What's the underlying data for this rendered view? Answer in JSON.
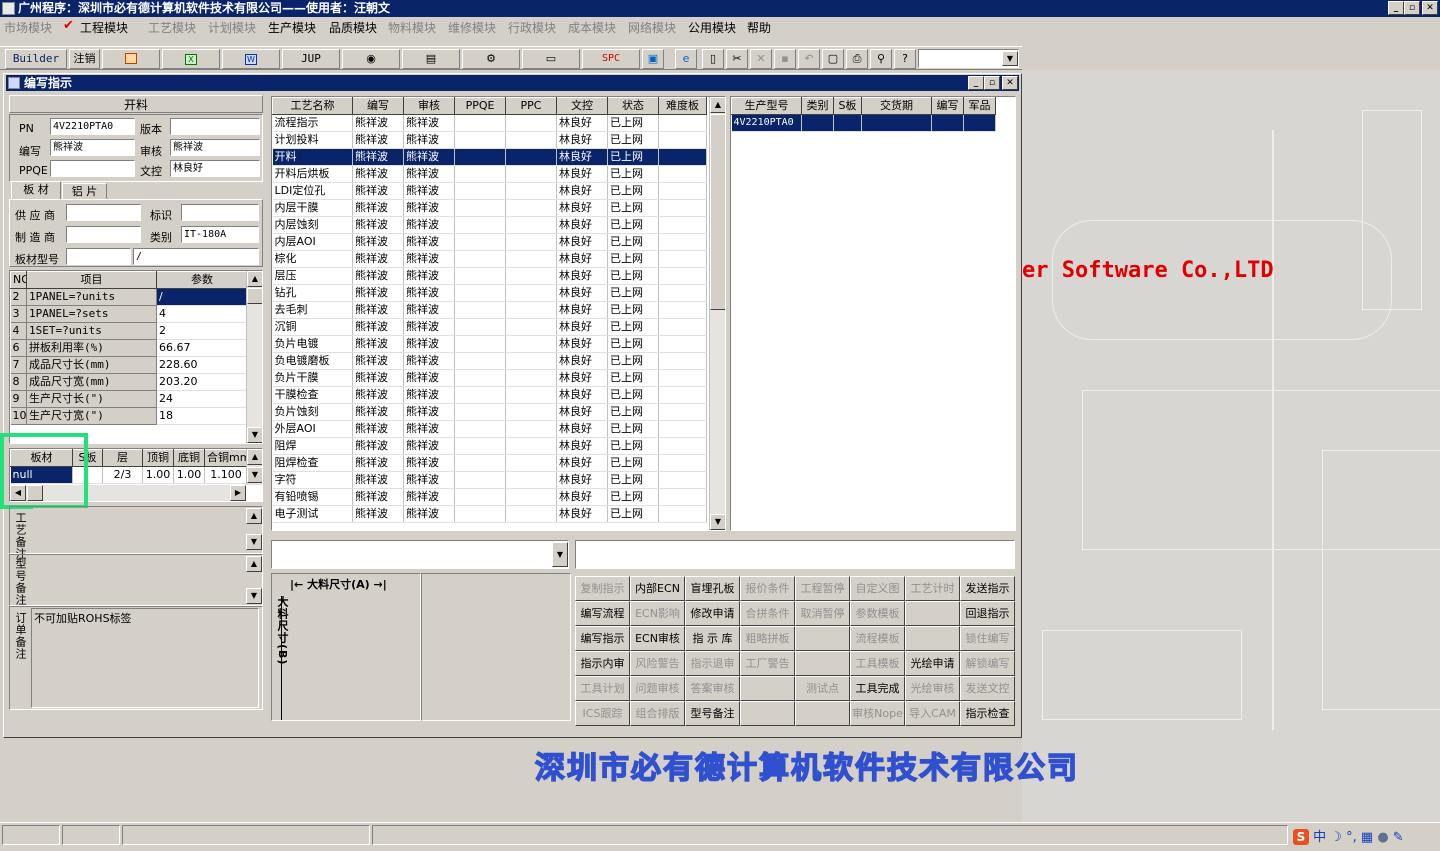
{
  "app": {
    "title": "广州程序：深圳市必有德计算机软件技术有限公司——使用者：汪朝文"
  },
  "menu": [
    {
      "label": "市场模块",
      "enabled": false
    },
    {
      "label": "工程模块",
      "enabled": true,
      "checked": true
    },
    {
      "label": "工艺模块",
      "enabled": false
    },
    {
      "label": "计划模块",
      "enabled": false
    },
    {
      "label": "生产模块",
      "enabled": true
    },
    {
      "label": "品质模块",
      "enabled": true
    },
    {
      "label": "物料模块",
      "enabled": false
    },
    {
      "label": "维修模块",
      "enabled": false
    },
    {
      "label": "行政模块",
      "enabled": false
    },
    {
      "label": "成本模块",
      "enabled": false
    },
    {
      "label": "网络模块",
      "enabled": false
    },
    {
      "label": "公用模块",
      "enabled": true
    },
    {
      "label": "帮助",
      "enabled": true
    }
  ],
  "toolbar": {
    "builder": "Builder",
    "logout": "注销",
    "jup": "JUP",
    "spc": "SPC",
    "icons": [
      "powerpoint-icon",
      "excel-icon",
      "word-icon",
      "eye-icon",
      "database-icon",
      "tools-icon",
      "printer-scanner-icon",
      "report-icon",
      "ie-icon",
      "new-doc-icon",
      "cut-icon",
      "delete-icon",
      "save-icon",
      "undo-icon",
      "preview-icon",
      "print-icon",
      "find-icon",
      "help-icon"
    ]
  },
  "window": {
    "title": "编写指示"
  },
  "info": {
    "heading": "开料",
    "pn_label": "PN",
    "pn": "4V2210PTA0",
    "version_label": "版本",
    "version": "",
    "author_label": "编写",
    "author": "熊祥波",
    "reviewer_label": "审核",
    "reviewer": "熊祥波",
    "ppqe_label": "PPQE",
    "ppqe": "",
    "doc_label": "文控",
    "doc": "林良好"
  },
  "material_tabs": [
    "板 材",
    "铝 片"
  ],
  "material": {
    "supplier_label": "供 应 商",
    "supplier": "",
    "mark_label": "标识",
    "mark": "",
    "maker_label": "制 造 商",
    "maker": "",
    "type_label": "类别",
    "type": "IT-180A",
    "model_label": "板材型号",
    "model": "",
    "model2": "/"
  },
  "params": {
    "headers": [
      "NO",
      "项目",
      "参数"
    ],
    "rows": [
      [
        "2",
        "1PANEL=?units",
        "/"
      ],
      [
        "3",
        "1PANEL=?sets",
        "4"
      ],
      [
        "4",
        "1SET=?units",
        "2"
      ],
      [
        "6",
        "拼板利用率(%)",
        "66.67"
      ],
      [
        "7",
        "成品尺寸长(mm)",
        "228.60"
      ],
      [
        "8",
        "成品尺寸宽(mm)",
        "203.20"
      ],
      [
        "9",
        "生产尺寸长(\")",
        "24"
      ],
      [
        "10",
        "生产尺寸宽(\")",
        "18"
      ]
    ]
  },
  "board": {
    "headers": [
      "板材",
      "S板",
      "层",
      "顶铜",
      "底铜",
      "合铜mm"
    ],
    "row": [
      "null",
      "",
      "2/3",
      "1.00",
      "1.00",
      "1.100"
    ]
  },
  "remarks": {
    "process_label": "工艺备注",
    "process": "",
    "model_label": "型号备注",
    "model": "",
    "order_label": "订单备注",
    "order": "不可加贴ROHS标签"
  },
  "process_table": {
    "headers": [
      "工艺名称",
      "编写",
      "审核",
      "PPQE",
      "PPC",
      "文控",
      "状态",
      "难度板"
    ],
    "selected_index": 2,
    "rows": [
      [
        "流程指示",
        "熊祥波",
        "熊祥波",
        "",
        "",
        "林良好",
        "已上网",
        ""
      ],
      [
        "计划投料",
        "熊祥波",
        "熊祥波",
        "",
        "",
        "林良好",
        "已上网",
        ""
      ],
      [
        "开料",
        "熊祥波",
        "熊祥波",
        "",
        "",
        "林良好",
        "已上网",
        ""
      ],
      [
        "开料后烘板",
        "熊祥波",
        "熊祥波",
        "",
        "",
        "林良好",
        "已上网",
        ""
      ],
      [
        "LDI定位孔",
        "熊祥波",
        "熊祥波",
        "",
        "",
        "林良好",
        "已上网",
        ""
      ],
      [
        "内层干膜",
        "熊祥波",
        "熊祥波",
        "",
        "",
        "林良好",
        "已上网",
        ""
      ],
      [
        "内层蚀刻",
        "熊祥波",
        "熊祥波",
        "",
        "",
        "林良好",
        "已上网",
        ""
      ],
      [
        "内层AOI",
        "熊祥波",
        "熊祥波",
        "",
        "",
        "林良好",
        "已上网",
        ""
      ],
      [
        "棕化",
        "熊祥波",
        "熊祥波",
        "",
        "",
        "林良好",
        "已上网",
        ""
      ],
      [
        "层压",
        "熊祥波",
        "熊祥波",
        "",
        "",
        "林良好",
        "已上网",
        ""
      ],
      [
        "钻孔",
        "熊祥波",
        "熊祥波",
        "",
        "",
        "林良好",
        "已上网",
        ""
      ],
      [
        "去毛刺",
        "熊祥波",
        "熊祥波",
        "",
        "",
        "林良好",
        "已上网",
        ""
      ],
      [
        "沉铜",
        "熊祥波",
        "熊祥波",
        "",
        "",
        "林良好",
        "已上网",
        ""
      ],
      [
        "负片电镀",
        "熊祥波",
        "熊祥波",
        "",
        "",
        "林良好",
        "已上网",
        ""
      ],
      [
        "负电镀磨板",
        "熊祥波",
        "熊祥波",
        "",
        "",
        "林良好",
        "已上网",
        ""
      ],
      [
        "负片干膜",
        "熊祥波",
        "熊祥波",
        "",
        "",
        "林良好",
        "已上网",
        ""
      ],
      [
        "干膜检查",
        "熊祥波",
        "熊祥波",
        "",
        "",
        "林良好",
        "已上网",
        ""
      ],
      [
        "负片蚀刻",
        "熊祥波",
        "熊祥波",
        "",
        "",
        "林良好",
        "已上网",
        ""
      ],
      [
        "外层AOI",
        "熊祥波",
        "熊祥波",
        "",
        "",
        "林良好",
        "已上网",
        ""
      ],
      [
        "阻焊",
        "熊祥波",
        "熊祥波",
        "",
        "",
        "林良好",
        "已上网",
        ""
      ],
      [
        "阻焊检查",
        "熊祥波",
        "熊祥波",
        "",
        "",
        "林良好",
        "已上网",
        ""
      ],
      [
        "字符",
        "熊祥波",
        "熊祥波",
        "",
        "",
        "林良好",
        "已上网",
        ""
      ],
      [
        "有铅喷锡",
        "熊祥波",
        "熊祥波",
        "",
        "",
        "林良好",
        "已上网",
        ""
      ],
      [
        "电子测试",
        "熊祥波",
        "熊祥波",
        "",
        "",
        "林良好",
        "已上网",
        ""
      ]
    ]
  },
  "product_table": {
    "headers": [
      "生产型号",
      "类别",
      "S板",
      "交货期",
      "编写",
      "军品"
    ],
    "rows": [
      [
        "4V2210PTA0",
        "",
        "",
        "",
        "",
        ""
      ]
    ]
  },
  "size": {
    "a_label": "大料尺寸(A)",
    "b_label": "大料尺寸(B)"
  },
  "actions": [
    [
      {
        "label": "复制指示",
        "enabled": false
      },
      {
        "label": "内部ECN",
        "enabled": true
      },
      {
        "label": "盲埋孔板",
        "enabled": true
      },
      {
        "label": "报价条件",
        "enabled": false
      },
      {
        "label": "工程暂停",
        "enabled": false
      },
      {
        "label": "自定义图",
        "enabled": false
      },
      {
        "label": "工艺计时",
        "enabled": false
      },
      {
        "label": "发送指示",
        "enabled": true
      }
    ],
    [
      {
        "label": "编写流程",
        "enabled": true
      },
      {
        "label": "ECN影响",
        "enabled": false
      },
      {
        "label": "修改申请",
        "enabled": true
      },
      {
        "label": "合拼条件",
        "enabled": false
      },
      {
        "label": "取消暂停",
        "enabled": false
      },
      {
        "label": "参数模板",
        "enabled": false
      },
      {
        "label": "",
        "enabled": false
      },
      {
        "label": "回退指示",
        "enabled": true
      }
    ],
    [
      {
        "label": "编写指示",
        "enabled": true
      },
      {
        "label": "ECN审核",
        "enabled": true
      },
      {
        "label": "指 示 库",
        "enabled": true
      },
      {
        "label": "粗略拼板",
        "enabled": false
      },
      {
        "label": "",
        "enabled": false
      },
      {
        "label": "流程模板",
        "enabled": false
      },
      {
        "label": "",
        "enabled": false
      },
      {
        "label": "锁住编写",
        "enabled": false
      }
    ],
    [
      {
        "label": "指示内审",
        "enabled": true
      },
      {
        "label": "风险警告",
        "enabled": false
      },
      {
        "label": "指示退审",
        "enabled": false
      },
      {
        "label": "工厂警告",
        "enabled": false
      },
      {
        "label": "",
        "enabled": false
      },
      {
        "label": "工具模板",
        "enabled": false
      },
      {
        "label": "光绘申请",
        "enabled": true
      },
      {
        "label": "解锁编写",
        "enabled": false
      }
    ],
    [
      {
        "label": "工具计划",
        "enabled": false
      },
      {
        "label": "问题审核",
        "enabled": false
      },
      {
        "label": "答案审核",
        "enabled": false
      },
      {
        "label": "",
        "enabled": false
      },
      {
        "label": "测试点",
        "enabled": false
      },
      {
        "label": "工具完成",
        "enabled": true
      },
      {
        "label": "光绘审核",
        "enabled": false
      },
      {
        "label": "发送文控",
        "enabled": false
      }
    ],
    [
      {
        "label": "ICS跟踪",
        "enabled": false
      },
      {
        "label": "组合排版",
        "enabled": false
      },
      {
        "label": "型号备注",
        "enabled": true
      },
      {
        "label": "",
        "enabled": false
      },
      {
        "label": "",
        "enabled": false
      },
      {
        "label": "审核Nope",
        "enabled": false
      },
      {
        "label": "导入CAM",
        "enabled": false
      },
      {
        "label": "指示检查",
        "enabled": true
      }
    ]
  ],
  "desktop": {
    "logo_en": "er Software Co.,LTD",
    "logo_cn": "深圳市必有德计算机软件技术有限公司"
  },
  "tray": {
    "ime": "中"
  },
  "colors": {
    "title_bg": "#0a246a",
    "logo_en": "#e00000",
    "logo_cn": "#3050d0",
    "highlight": "#22e07a"
  }
}
